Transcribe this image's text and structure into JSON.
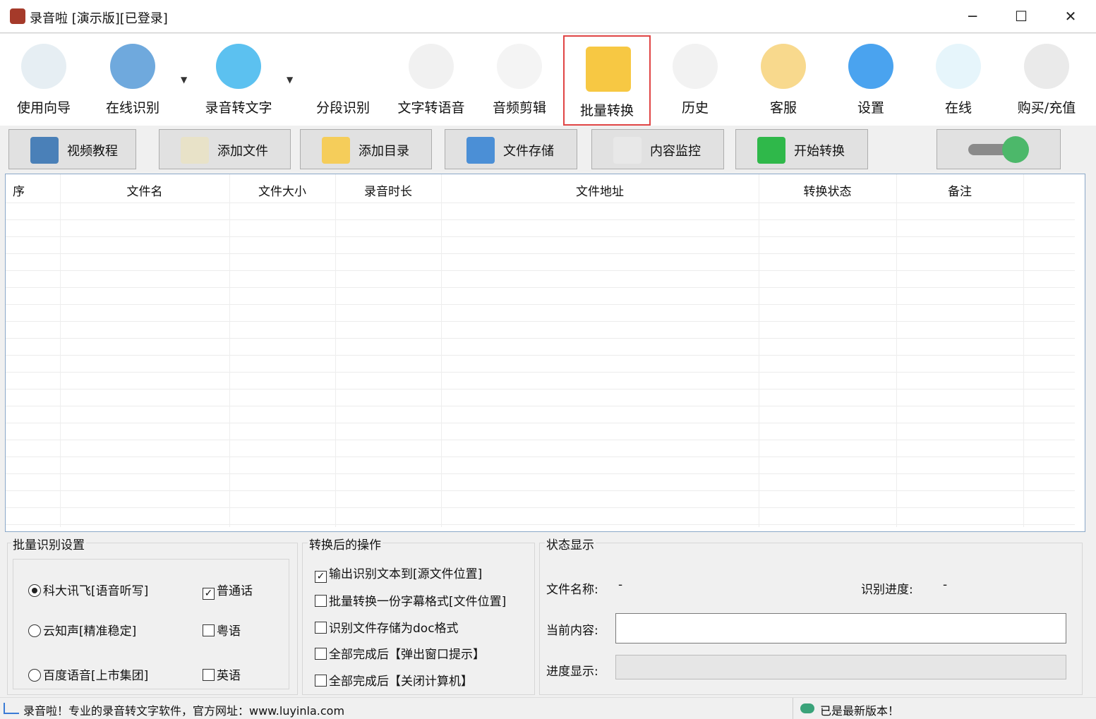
{
  "window": {
    "title": "录音啦 [演示版][已登录]",
    "minimize": "─",
    "maximize": "☐",
    "close": "✕"
  },
  "toolbar": [
    {
      "label": "使用向导",
      "icon": "navigation-arrow-icon",
      "color": "#e6eef3"
    },
    {
      "label": "在线识别",
      "icon": "microphone-icon",
      "color": "#6fa9dd"
    },
    {
      "label": "录音转文字",
      "icon": "w-logo-icon",
      "color": "#5cc1f0"
    },
    {
      "label": "分段识别",
      "icon": "sound-wave-icon",
      "color": "#ffffff"
    },
    {
      "label": "文字转语音",
      "icon": "megaphone-icon",
      "color": "#f1f1f1"
    },
    {
      "label": "音频剪辑",
      "icon": "scissors-icon",
      "color": "#f4f4f4"
    },
    {
      "label": "批量转换",
      "icon": "folder-arrow-icon",
      "color": "#f7c843"
    },
    {
      "label": "历史",
      "icon": "history-clock-icon",
      "color": "#f2f2f2"
    },
    {
      "label": "客服",
      "icon": "sleeping-bed-icon",
      "color": "#f8d98d"
    },
    {
      "label": "设置",
      "icon": "lifebuoy-icon",
      "color": "#4aa3ef"
    },
    {
      "label": "在线",
      "icon": "user-circle-icon",
      "color": "#e6f5fb"
    },
    {
      "label": "购买/充值",
      "icon": "dollar-cursor-icon",
      "color": "#eaeaea"
    }
  ],
  "dropdown_glyph": "▼",
  "actions": [
    {
      "label": "视频教程",
      "icon": "video-camera-icon",
      "color": "#4a80b8"
    },
    {
      "label": "添加文件",
      "icon": "add-file-icon",
      "color": "#e8e2c8"
    },
    {
      "label": "添加目录",
      "icon": "folder-icon",
      "color": "#f5cd5a"
    },
    {
      "label": "文件存储",
      "icon": "floppy-disk-icon",
      "color": "#4b8fd6"
    },
    {
      "label": "内容监控",
      "icon": "lightning-icon",
      "color": "#e8e8e8"
    },
    {
      "label": "开始转换",
      "icon": "play-icon",
      "color": "#2fb84a"
    }
  ],
  "toggle": {
    "on": true,
    "color": "#4cb86a"
  },
  "table": {
    "headers": [
      "序",
      "文件名",
      "文件大小",
      "录音时长",
      "文件地址",
      "转换状态",
      "备注"
    ],
    "rows": []
  },
  "batch_settings": {
    "title": "批量识别设置",
    "engines": [
      {
        "label": "科大讯飞[语音听写]",
        "selected": true
      },
      {
        "label": "云知声[精准稳定]",
        "selected": false
      },
      {
        "label": "百度语音[上市集团]",
        "selected": false
      }
    ],
    "languages": [
      {
        "label": "普通话",
        "checked": true
      },
      {
        "label": "粤语",
        "checked": false
      },
      {
        "label": "英语",
        "checked": false
      }
    ]
  },
  "after_ops": {
    "title": "转换后的操作",
    "options": [
      {
        "label": "输出识别文本到[源文件位置]",
        "checked": true
      },
      {
        "label": "批量转换一份字幕格式[文件位置]",
        "checked": false
      },
      {
        "label": "识别文件存储为doc格式",
        "checked": false
      },
      {
        "label": "全部完成后【弹出窗口提示】",
        "checked": false
      },
      {
        "label": "全部完成后【关闭计算机】",
        "checked": false
      }
    ]
  },
  "status_panel": {
    "title": "状态显示",
    "file_name_label": "文件名称:",
    "file_name": "-",
    "progress_label": "识别进度:",
    "progress": "-",
    "current_label": "当前内容:",
    "current": "",
    "bar_label": "进度显示:",
    "bar_percent": 0
  },
  "statusbar": {
    "left": "录音啦！专业的录音转文字软件，官方网址：www.luyinla.com",
    "right": "已是最新版本！"
  }
}
